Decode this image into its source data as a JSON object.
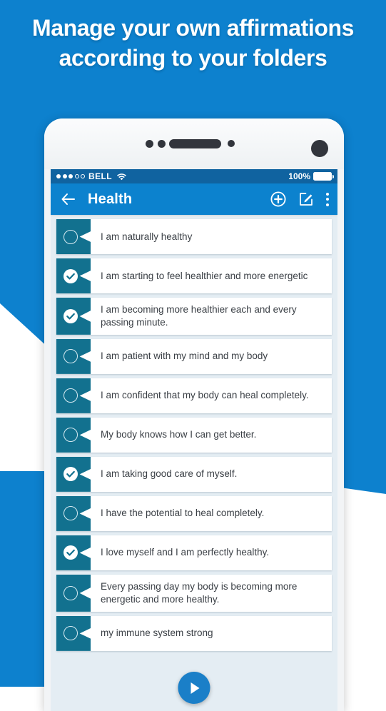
{
  "promo": {
    "headline": "Manage your own affirmations according to your folders",
    "background_color": "#0d81ce"
  },
  "statusbar": {
    "carrier": "BELL",
    "signal_dots_filled": 3,
    "signal_dots_empty": 2,
    "wifi_icon": "wifi-icon",
    "battery_percent": "100%",
    "battery_icon": "battery-full-icon",
    "background_color": "#1063a0"
  },
  "appbar": {
    "back_icon": "arrow-left-icon",
    "title": "Health",
    "add_icon": "plus-circle-icon",
    "edit_icon": "edit-square-icon",
    "overflow_icon": "more-vertical-icon",
    "background_color": "#0c82ce"
  },
  "list": {
    "ribbon_color": "#12718f",
    "items": [
      {
        "text": "I am naturally healthy",
        "checked": false
      },
      {
        "text": "I am starting to feel healthier and more energetic",
        "checked": true
      },
      {
        "text": "I am becoming more healthier each and every passing minute.",
        "checked": true
      },
      {
        "text": "I am patient with my mind and my body",
        "checked": false
      },
      {
        "text": "I am confident that my body can heal completely.",
        "checked": false
      },
      {
        "text": "My body knows how I can get better.",
        "checked": false
      },
      {
        "text": "I am taking good care of myself.",
        "checked": true
      },
      {
        "text": "I have the potential to heal completely.",
        "checked": false
      },
      {
        "text": "I love myself and I am perfectly healthy.",
        "checked": true
      },
      {
        "text": "Every passing day my body is becoming more energetic and more healthy.",
        "checked": false
      },
      {
        "text": "my immune system strong",
        "checked": false
      }
    ]
  },
  "fab": {
    "icon": "play-icon",
    "color": "#1a7fc8"
  }
}
